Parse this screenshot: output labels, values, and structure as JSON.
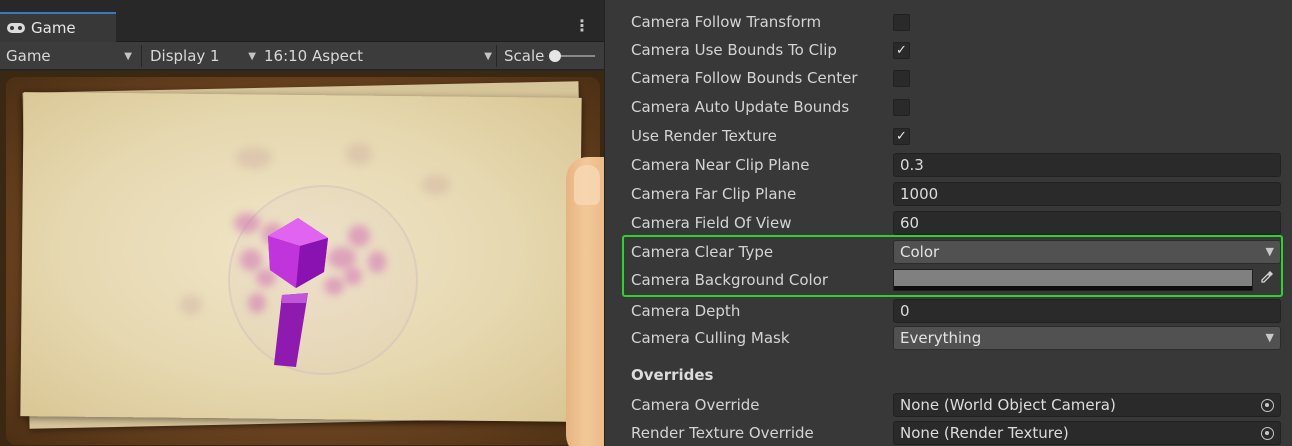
{
  "game_panel": {
    "tab": {
      "label": "Game",
      "icon": "gamepad-icon"
    },
    "menu_icon": "⋮",
    "toolbar": {
      "mode": "Game",
      "display": "Display 1",
      "aspect": "16:10 Aspect",
      "scale_label": "Scale",
      "scale_value": 0.0
    }
  },
  "inspector": {
    "rows": [
      {
        "label": "Camera Follow Transform",
        "type": "checkbox",
        "checked": false
      },
      {
        "label": "Camera Use Bounds To Clip",
        "type": "checkbox",
        "checked": true,
        "mark": "✓"
      },
      {
        "label": "Camera Follow Bounds Center",
        "type": "checkbox",
        "checked": false
      },
      {
        "label": "Camera Auto Update Bounds",
        "type": "checkbox",
        "checked": false
      },
      {
        "label": "Use Render Texture",
        "type": "checkbox",
        "checked": true,
        "mark": "✓"
      },
      {
        "label": "Camera Near Clip Plane",
        "type": "number",
        "value": "0.3"
      },
      {
        "label": "Camera Far Clip Plane",
        "type": "number",
        "value": "1000"
      },
      {
        "label": "Camera Field Of View",
        "type": "number",
        "value": "60"
      },
      {
        "label": "Camera Clear Type",
        "type": "dropdown",
        "value": "Color"
      },
      {
        "label": "Camera Background Color",
        "type": "color",
        "value": "#808080"
      },
      {
        "label": "Camera Depth",
        "type": "number",
        "value": "0"
      },
      {
        "label": "Camera Culling Mask",
        "type": "dropdown",
        "value": "Everything"
      }
    ],
    "overrides": {
      "header": "Overrides",
      "rows": [
        {
          "label": "Camera Override",
          "value": "None (World Object Camera)"
        },
        {
          "label": "Render Texture Override",
          "value": "None (Render Texture)"
        }
      ]
    },
    "highlight_color": "#2ed12e"
  }
}
